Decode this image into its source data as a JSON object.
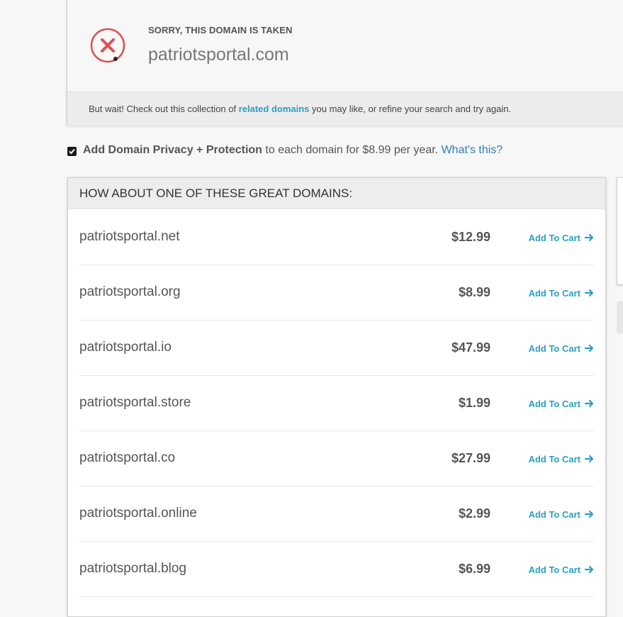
{
  "taken": {
    "heading": "SORRY, THIS DOMAIN IS TAKEN",
    "domain": "patriotsportal.com",
    "footer_prefix": "But wait! Check out this collection of ",
    "footer_link": "related domains",
    "footer_suffix": " you may like, or refine your search and try again."
  },
  "privacy": {
    "checked": true,
    "bold_label": "Add Domain Privacy + Protection",
    "rest": " to each domain for $8.99 per year. ",
    "whats_this": "What's this?"
  },
  "suggestions": {
    "title": "HOW ABOUT ONE OF THESE GREAT DOMAINS:",
    "cart_label": "Add To Cart",
    "rows": [
      {
        "domain": "patriotsportal.net",
        "price": "$12.99"
      },
      {
        "domain": "patriotsportal.org",
        "price": "$8.99"
      },
      {
        "domain": "patriotsportal.io",
        "price": "$47.99"
      },
      {
        "domain": "patriotsportal.store",
        "price": "$1.99"
      },
      {
        "domain": "patriotsportal.co",
        "price": "$27.99"
      },
      {
        "domain": "patriotsportal.online",
        "price": "$2.99"
      },
      {
        "domain": "patriotsportal.blog",
        "price": "$6.99"
      }
    ]
  },
  "colors": {
    "accent": "#2b9fc1",
    "error": "#d9534f",
    "link_blue": "#2d7fb8"
  },
  "icons": {
    "status": "x-circle-icon",
    "cart_arrow": "arrow-right-icon",
    "checkbox": "checkmark-icon"
  }
}
